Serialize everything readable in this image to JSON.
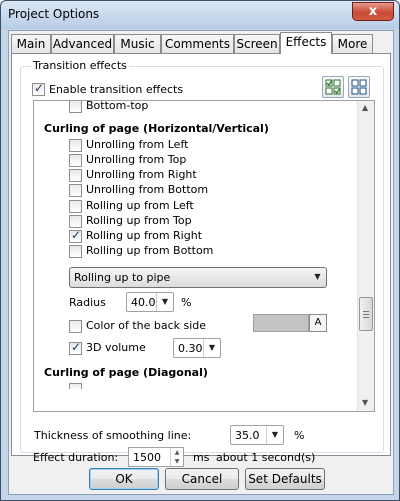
{
  "window": {
    "title": "Project Options",
    "close_label": "x"
  },
  "tabs": [
    {
      "label": "Main"
    },
    {
      "label": "Advanced"
    },
    {
      "label": "Music"
    },
    {
      "label": "Comments"
    },
    {
      "label": "Screen"
    },
    {
      "label": "Effects",
      "active": true
    },
    {
      "label": "More"
    }
  ],
  "group": {
    "legend": "Transition effects",
    "enable_label": "Enable transition effects",
    "enable_checked": true
  },
  "list": {
    "partial_top_item": "Bottom-top",
    "section_curling": "Curling of page (Horizontal/Vertical)",
    "items": [
      {
        "label": "Unrolling from Left",
        "checked": false
      },
      {
        "label": "Unrolling from Top",
        "checked": false
      },
      {
        "label": "Unrolling from Right",
        "checked": false
      },
      {
        "label": "Unrolling from Bottom",
        "checked": false
      },
      {
        "label": "Rolling up from Left",
        "checked": false
      },
      {
        "label": "Rolling up from Top",
        "checked": false
      },
      {
        "label": "Rolling up from Right",
        "checked": true
      },
      {
        "label": "Rolling up from Bottom",
        "checked": false
      }
    ],
    "mode_select_value": "Rolling up to pipe",
    "radius_label": "Radius",
    "radius_value": "40.0",
    "radius_unit": "%",
    "back_color_label": "Color of the back side",
    "back_color_checked": false,
    "back_color_value": "#c4c4c4",
    "back_color_btn": "A",
    "volume_label": "3D volume",
    "volume_checked": true,
    "volume_value": "0.30",
    "section_diagonal": "Curling of page (Diagonal)"
  },
  "smoothing": {
    "label": "Thickness of smoothing line:",
    "value": "35.0",
    "unit": "%"
  },
  "duration": {
    "label": "Effect duration:",
    "value": "1500",
    "unit": "ms",
    "hint": "about 1 second(s)"
  },
  "buttons": {
    "ok": "OK",
    "cancel": "Cancel",
    "set_defaults": "Set Defaults"
  }
}
